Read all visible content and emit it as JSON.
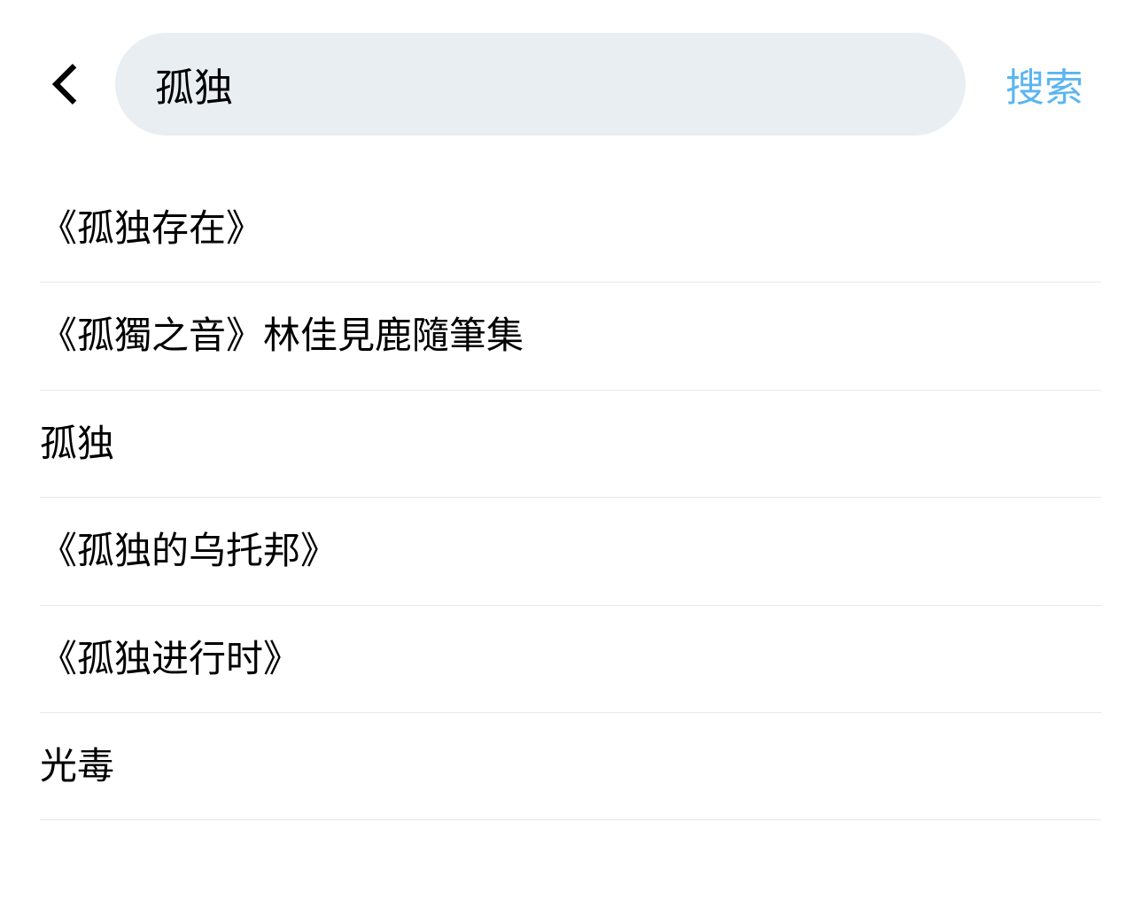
{
  "search": {
    "query": "孤独",
    "submit_label": "搜索"
  },
  "results": [
    {
      "title": "《孤独存在》"
    },
    {
      "title": "《孤獨之音》林佳見鹿隨筆集"
    },
    {
      "title": "孤独"
    },
    {
      "title": "《孤独的乌托邦》"
    },
    {
      "title": "《孤独进行时》"
    },
    {
      "title": "光毒"
    }
  ]
}
